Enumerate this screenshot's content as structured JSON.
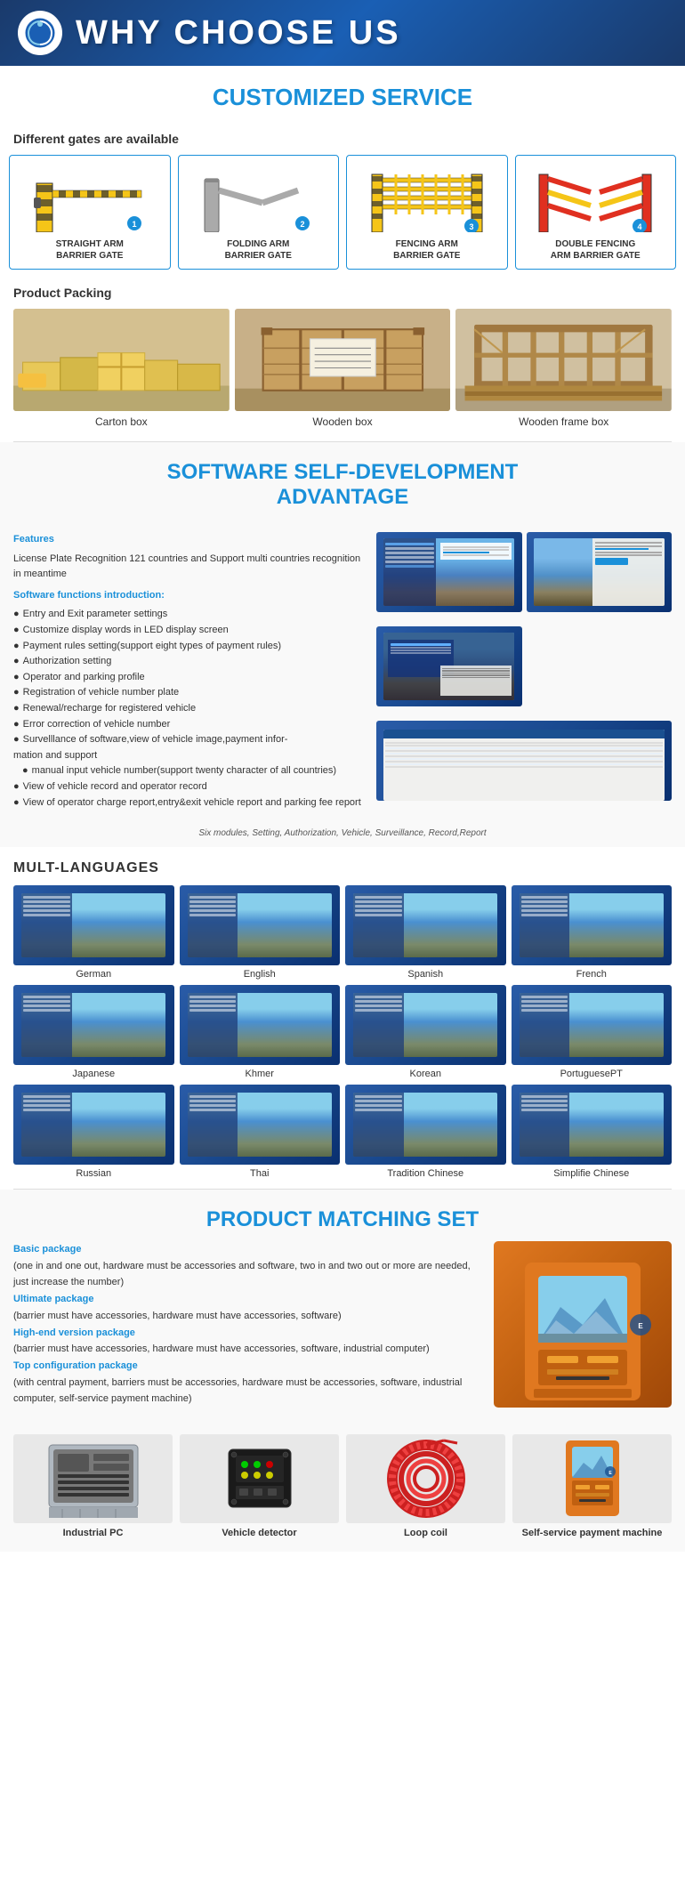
{
  "header": {
    "title": "WHY CHOOSE US",
    "logo": "N"
  },
  "customized": {
    "heading_blue": "CUSTOMIZED",
    "heading_rest": " SERVICE",
    "gates_subtitle": "Different gates are available",
    "gates": [
      {
        "label": "STRAIGHT ARM\nBARRIER GATE",
        "number": "1"
      },
      {
        "label": "FOLDING ARM\nBARRIER GATE",
        "number": "2"
      },
      {
        "label": "FENCING ARM\nBARRIER GATE",
        "number": "3"
      },
      {
        "label": "DOUBLE FENCING\nARM BARRIER GATE",
        "number": "4"
      }
    ],
    "packing_subtitle": "Product Packing",
    "packing": [
      {
        "label": "Carton box"
      },
      {
        "label": "Wooden box"
      },
      {
        "label": "Wooden frame box"
      }
    ]
  },
  "software": {
    "heading_blue": "SOFTWARE",
    "heading_rest": " SELF-DEVELOPMENT\nADVANTAGE",
    "features_title": "Features",
    "features_desc": "License Plate Recognition 121 countries and Support multi countries recognition in meantime",
    "intro_title": "Software functions introduction:",
    "functions": [
      "Entry and Exit parameter settings",
      "Customize display words in LED display screen",
      "Payment rules setting(support eight types of payment rules)",
      "Authorization setting",
      "Operator and parking profile",
      "Registration of vehicle number plate",
      "Renewal/recharge for registered vehicle",
      "Error correction of vehicle number",
      "Survelllance of software,view of vehicle image,payment information and support",
      "manual input vehicle number(support twenty character of all countries)",
      "View of vehicle record and operator record",
      "View of operator charge report,entry&exit vehicle report and parking fee report"
    ],
    "caption": "Six modules, Setting, Authorization, Vehicle, Surveillance, Record,Report"
  },
  "languages": {
    "title": "MULT-LANGUAGES",
    "items": [
      {
        "label": "German"
      },
      {
        "label": "English"
      },
      {
        "label": "Spanish"
      },
      {
        "label": "French"
      },
      {
        "label": "Japanese"
      },
      {
        "label": "Khmer"
      },
      {
        "label": "Korean"
      },
      {
        "label": "PortuguesePT"
      },
      {
        "label": "Russian"
      },
      {
        "label": "Thai"
      },
      {
        "label": "Tradition Chinese"
      },
      {
        "label": "Simplifie Chinese"
      }
    ]
  },
  "product": {
    "heading_blue": "PRODUCT",
    "heading_rest": " MATCHING SET",
    "packages": [
      {
        "title": "Basic package",
        "desc": "(one in and one out, hardware must be accessories and software, two in and two out or more are needed, just increase the number)"
      },
      {
        "title": "Ultimate package",
        "desc": "(barrier must have accessories, hardware must have accessories, software)"
      },
      {
        "title": "High-end version package",
        "desc": "(barrier must have accessories, hardware must have accessories, software, industrial computer)"
      },
      {
        "title": "Top configuration package",
        "desc": "(with central payment, barriers must be accessories, hardware must be accessories, software, industrial computer, self-service payment machine)"
      }
    ],
    "components": [
      {
        "label": "Industrial PC"
      },
      {
        "label": "Vehicle detector"
      },
      {
        "label": "Loop coil"
      },
      {
        "label": "Self-service payment machine"
      }
    ]
  }
}
